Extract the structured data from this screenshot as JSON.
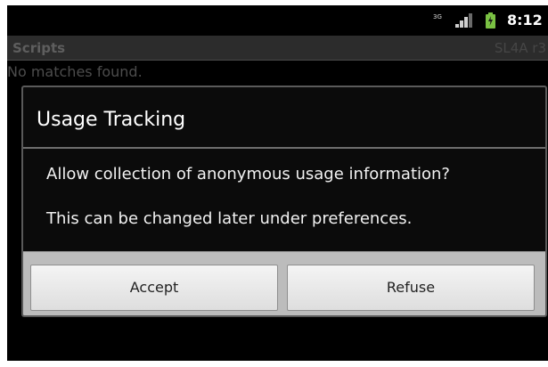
{
  "status_bar": {
    "sim_icon": "sim-3g-icon",
    "sim_text": "3G",
    "signal_icon": "signal-strength-icon",
    "battery_icon": "battery-charging-icon",
    "time": "8:12"
  },
  "app_bar": {
    "title": "Scripts",
    "version": "SL4A r3"
  },
  "main": {
    "empty_message": "No matches found."
  },
  "dialog": {
    "title": "Usage Tracking",
    "message_1": "Allow collection of anonymous usage information?",
    "message_2": "This can be changed later under preferences.",
    "accept_label": "Accept",
    "refuse_label": "Refuse"
  },
  "colors": {
    "background": "#000000",
    "battery_accent": "#7ac143",
    "button_bar": "#bcbcbc"
  }
}
